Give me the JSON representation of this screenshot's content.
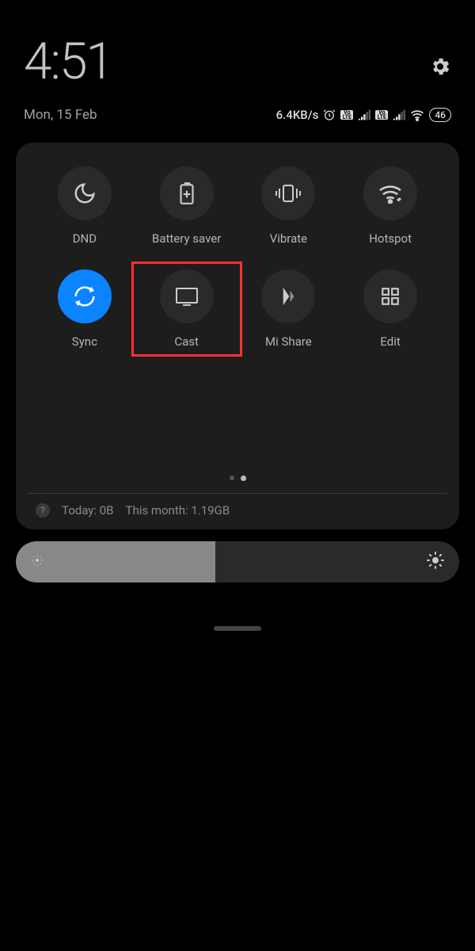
{
  "header": {
    "time": "4:51",
    "date": "Mon, 15 Feb"
  },
  "status": {
    "net_speed": "6.4KB/s",
    "battery_level": "46",
    "sim1_badge": "Vo\nLTE",
    "sim2_badge": "Vo\nLTE"
  },
  "tiles": [
    {
      "label": "DND",
      "icon": "moon",
      "active": false
    },
    {
      "label": "Battery saver",
      "icon": "battery-plus",
      "active": false
    },
    {
      "label": "Vibrate",
      "icon": "vibrate",
      "active": false
    },
    {
      "label": "Hotspot",
      "icon": "hotspot",
      "active": false
    },
    {
      "label": "Sync",
      "icon": "sync",
      "active": true
    },
    {
      "label": "Cast",
      "icon": "cast",
      "active": false,
      "highlighted": true
    },
    {
      "label": "Mi Share",
      "icon": "mishare",
      "active": false
    },
    {
      "label": "Edit",
      "icon": "grid",
      "active": false
    }
  ],
  "data_usage": {
    "today_label": "Today: 0B",
    "month_label": "This month: 1.19GB"
  },
  "brightness": {
    "percent": 45
  }
}
